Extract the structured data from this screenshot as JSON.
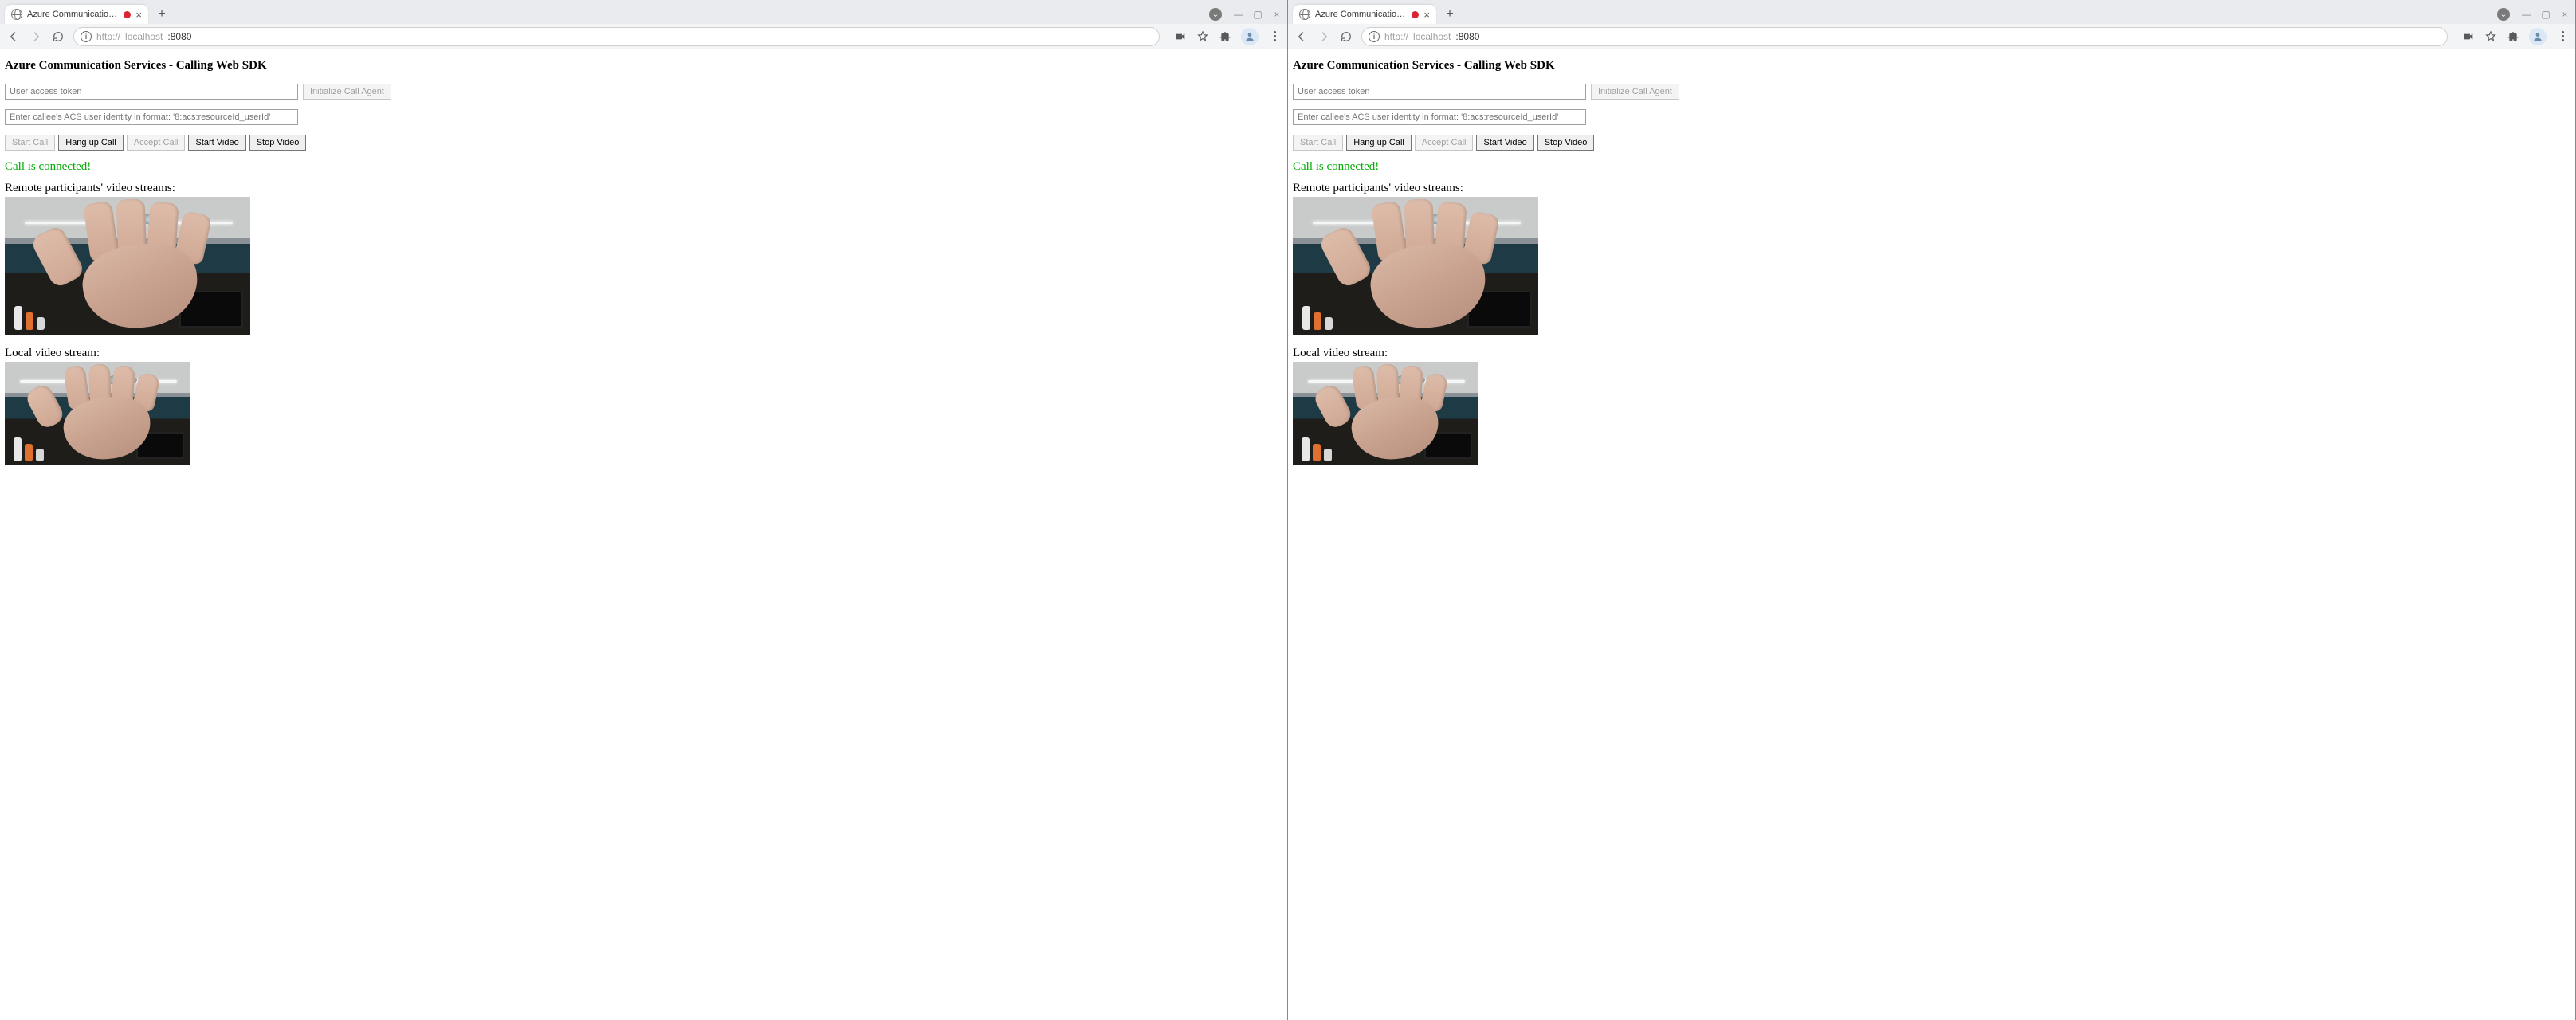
{
  "browser": {
    "tab_title": "Azure Communication Servic",
    "url_protocol": "http://",
    "url_host": "localhost",
    "url_port": ":8080",
    "info_glyph": "i",
    "new_tab_glyph": "+",
    "close_glyph": "×",
    "chevron_glyph": "⌄",
    "minimize_glyph": "—",
    "maximize_glyph": "▢",
    "win_close_glyph": "×"
  },
  "page": {
    "title": "Azure Communication Services - Calling Web SDK",
    "token": {
      "placeholder": "User access token"
    },
    "init_button": "Initialize Call Agent",
    "callee": {
      "placeholder": "Enter callee's ACS user identity in format: '8:acs:resourceId_userId'"
    },
    "buttons": {
      "start": "Start Call",
      "hangup": "Hang up Call",
      "accept": "Accept Call",
      "start_video": "Start Video",
      "stop_video": "Stop Video"
    },
    "status": "Call is connected!",
    "remote_label": "Remote participants' video streams:",
    "local_label": "Local video stream:"
  }
}
